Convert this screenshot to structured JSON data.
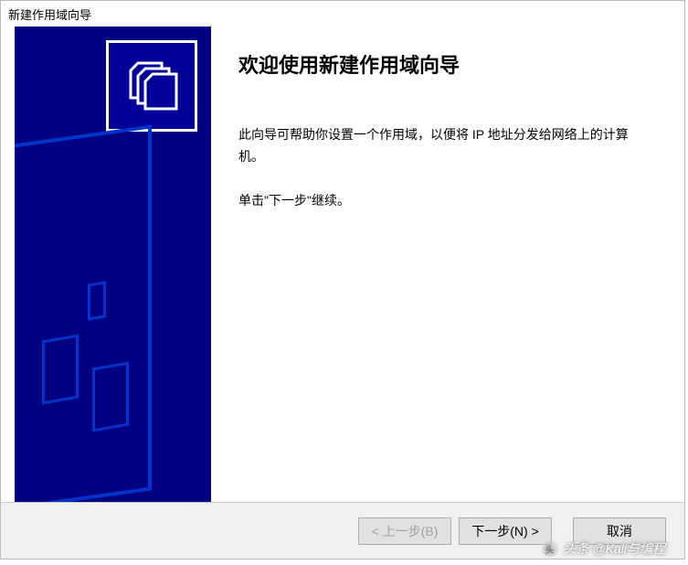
{
  "window": {
    "title": "新建作用域向导"
  },
  "sidebar": {
    "icon_name": "folders-icon"
  },
  "main": {
    "heading": "欢迎使用新建作用域向导",
    "description": "此向导可帮助你设置一个作用域，以便将 IP 地址分发给网络上的计算机。",
    "instruction": "单击\"下一步\"继续。"
  },
  "buttons": {
    "back_label": "< 上一步(B)",
    "next_label": "下一步(N) >",
    "cancel_label": "取消"
  },
  "watermark": {
    "text": "头条 @Kali与编程"
  }
}
